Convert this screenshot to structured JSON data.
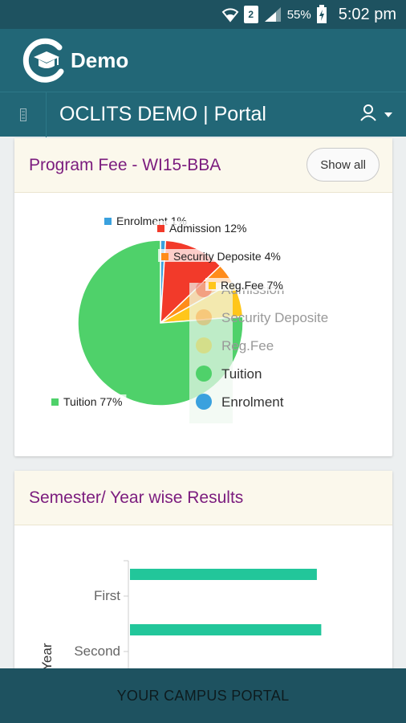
{
  "status_bar": {
    "sim_slot": "2",
    "battery": "55%",
    "time": "5:02 pm",
    "icons": [
      "wifi-icon",
      "signal-icon",
      "battery-charging-icon"
    ]
  },
  "app_bar": {
    "title": "Demo",
    "logo_icon": "graduation-cap-logo"
  },
  "portal_bar": {
    "title": "OCLITS DEMO | Portal",
    "icons": [
      "menu-handle-icon",
      "user-icon",
      "chevron-down-icon"
    ]
  },
  "fee_card": {
    "title": "Program Fee - WI15-BBA",
    "show_all": "Show all"
  },
  "results_card": {
    "title": "Semester/ Year wise Results"
  },
  "footer": {
    "text": "YOUR CAMPUS PORTAL"
  },
  "chart_data": [
    {
      "type": "pie",
      "slices": [
        {
          "label": "Enrolment 1%",
          "name": "Enrolment",
          "value": 1,
          "color": "#3aa1de"
        },
        {
          "label": "Admission 12%",
          "name": "Admission",
          "value": 12,
          "color": "#f23a2a"
        },
        {
          "label": "Security Deposite 4%",
          "name": "Security Deposite",
          "value": 4,
          "color": "#ff8c1a"
        },
        {
          "label": "Reg.Fee 7%",
          "name": "Reg.Fee",
          "value": 7,
          "color": "#ffc61a"
        },
        {
          "label": "Tuition 77%",
          "name": "Tuition",
          "value": 77,
          "color": "#4fd16a"
        }
      ],
      "legend": [
        {
          "name": "Admission",
          "color": "#f23a2a"
        },
        {
          "name": "Security Deposite",
          "color": "#ff8c1a"
        },
        {
          "name": "Reg.Fee",
          "color": "#ffc61a"
        },
        {
          "name": "Tuition",
          "color": "#4fd16a"
        },
        {
          "name": "Enrolment",
          "color": "#3aa1de"
        }
      ],
      "legend_placement": "right"
    },
    {
      "type": "bar",
      "orientation": "horizontal",
      "categories": [
        "First",
        "Second"
      ],
      "values": [
        85,
        87
      ],
      "xlim": [
        0,
        100
      ],
      "ylabel": "/ Year",
      "color": "#22c69a"
    }
  ]
}
